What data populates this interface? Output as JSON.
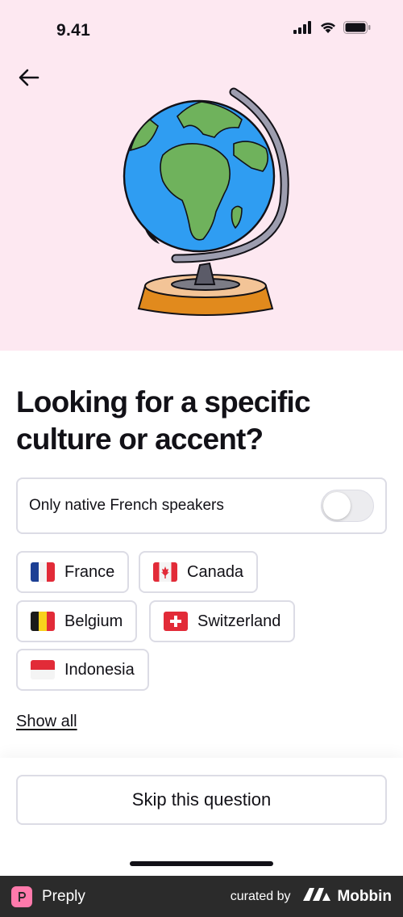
{
  "status_bar": {
    "time": "9.41"
  },
  "header": {
    "back_icon": "arrow-left-icon",
    "illustration": "globe-illustration"
  },
  "main": {
    "title": "Looking for a specific culture or accent?",
    "native_toggle": {
      "label": "Only native French speakers",
      "checked": false
    },
    "countries": [
      {
        "label": "France",
        "flag": "france-flag-icon"
      },
      {
        "label": "Canada",
        "flag": "canada-flag-icon"
      },
      {
        "label": "Belgium",
        "flag": "belgium-flag-icon"
      },
      {
        "label": "Switzerland",
        "flag": "switzerland-flag-icon"
      },
      {
        "label": "Indonesia",
        "flag": "indonesia-flag-icon"
      }
    ],
    "show_all_label": "Show all"
  },
  "bottom": {
    "skip_label": "Skip this question"
  },
  "footer": {
    "brand": "Preply",
    "curated_by": "curated by",
    "curator": "Mobbin"
  },
  "colors": {
    "hero_bg": "#fde8f1",
    "border": "#dcdce5",
    "text": "#121117",
    "footer_bg": "#2b2b2b",
    "preply_pink": "#ff7aac"
  }
}
